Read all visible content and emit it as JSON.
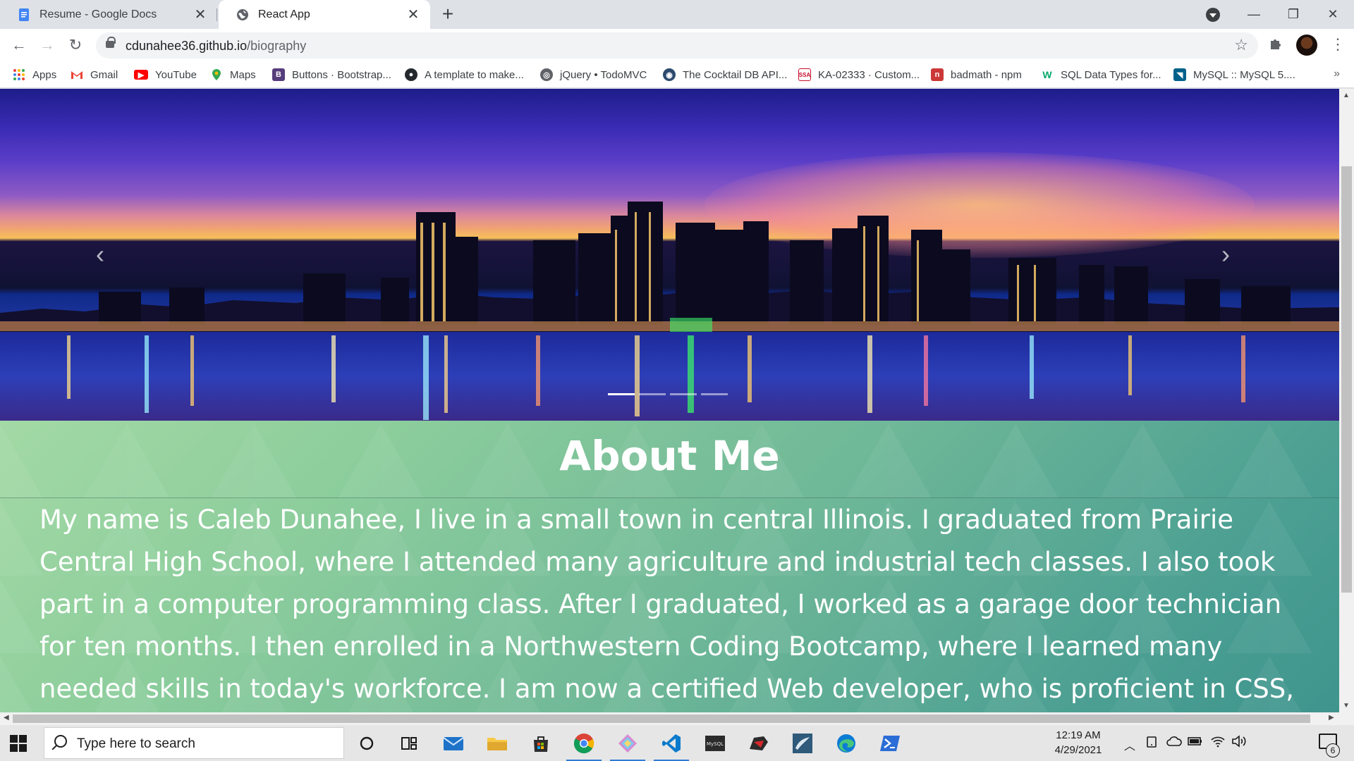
{
  "browser": {
    "tabs": [
      {
        "title": "Resume - Google Docs",
        "icon": "google-docs-icon"
      },
      {
        "title": "React App",
        "icon": "globe-icon"
      }
    ],
    "url_host": "cdunahee36.github.io",
    "url_path": "/biography"
  },
  "bookmarks": [
    {
      "label": "Apps",
      "icon": "apps-grid-icon"
    },
    {
      "label": "Gmail",
      "icon": "gmail-icon"
    },
    {
      "label": "YouTube",
      "icon": "youtube-icon"
    },
    {
      "label": "Maps",
      "icon": "maps-icon"
    },
    {
      "label": "Buttons · Bootstrap...",
      "icon": "bootstrap-icon"
    },
    {
      "label": "A template to make...",
      "icon": "github-icon"
    },
    {
      "label": "jQuery • TodoMVC",
      "icon": "globe-icon"
    },
    {
      "label": "The Cocktail DB API...",
      "icon": "cocktaildb-icon"
    },
    {
      "label": "KA-02333 · Custom...",
      "icon": "ssa-icon"
    },
    {
      "label": "badmath - npm",
      "icon": "npm-icon"
    },
    {
      "label": "SQL Data Types for...",
      "icon": "w3schools-icon"
    },
    {
      "label": "MySQL :: MySQL 5....",
      "icon": "mysql-icon"
    }
  ],
  "page": {
    "carousel": {
      "slide_count": 4,
      "active_index": 0
    },
    "about_title": "About Me",
    "about_text": "My name is Caleb Dunahee, I live in a small town in central Illinois. I graduated from Prairie Central High School, where I attended many agriculture and industrial tech classes. I also took part in a computer programming class. After I graduated, I worked as a garage door technician for ten months. I then enrolled in a Northwestern Coding Bootcamp, where I learned many needed skills in today's workforce. I am now a certified Web developer, who is proficient in CSS,"
  },
  "taskbar": {
    "search_placeholder": "Type here to search",
    "time": "12:19 AM",
    "date": "4/29/2021",
    "notification_count": "6"
  },
  "colors": {
    "about_bg_start": "#a3d9a5",
    "about_bg_end": "#3f958d",
    "taskbar_active": "#2f7bd6"
  }
}
